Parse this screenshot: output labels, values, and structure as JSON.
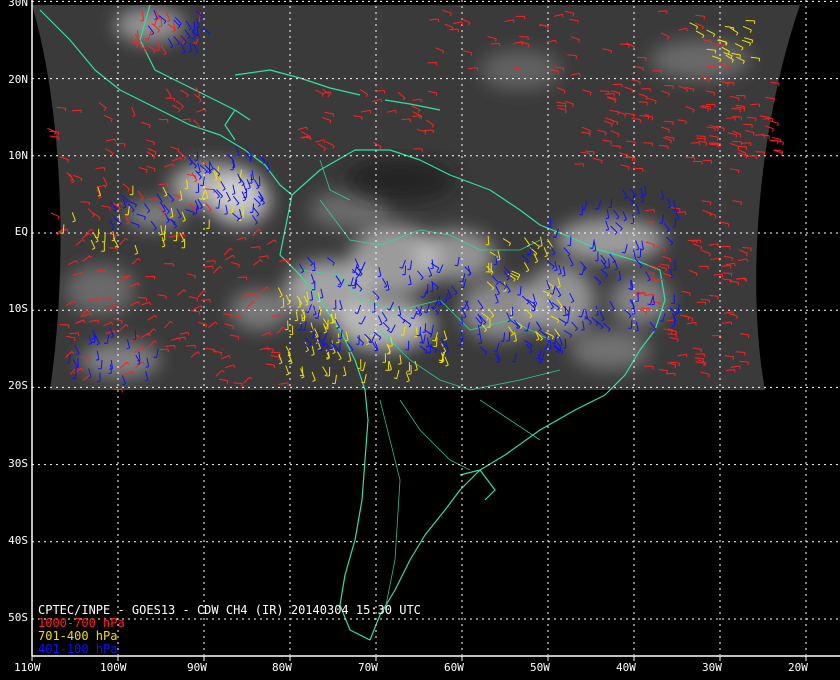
{
  "map": {
    "title": "CPTEC/INPE - GOES13 - CDW CH4 (IR) 20140304 15:30 UTC",
    "legend": [
      {
        "label": "1000-700 hPa",
        "color": "#ff2020"
      },
      {
        "label": "701-400 hPa",
        "color": "#f0e000"
      },
      {
        "label": "401-100 hPa",
        "color": "#1010ff"
      }
    ],
    "lat_labels": [
      "30N",
      "20N",
      "10N",
      "EQ",
      "10S",
      "20S",
      "30S",
      "40S",
      "50S"
    ],
    "lon_labels": [
      "110W",
      "100W",
      "90W",
      "80W",
      "70W",
      "60W",
      "50W",
      "40W",
      "30W",
      "20W"
    ],
    "colors": {
      "coastline": "#30e0a0",
      "grid": "#ffffff",
      "satellite_dark": "#3a3a3a",
      "satellite_cloud": "#dcdcdc"
    }
  }
}
